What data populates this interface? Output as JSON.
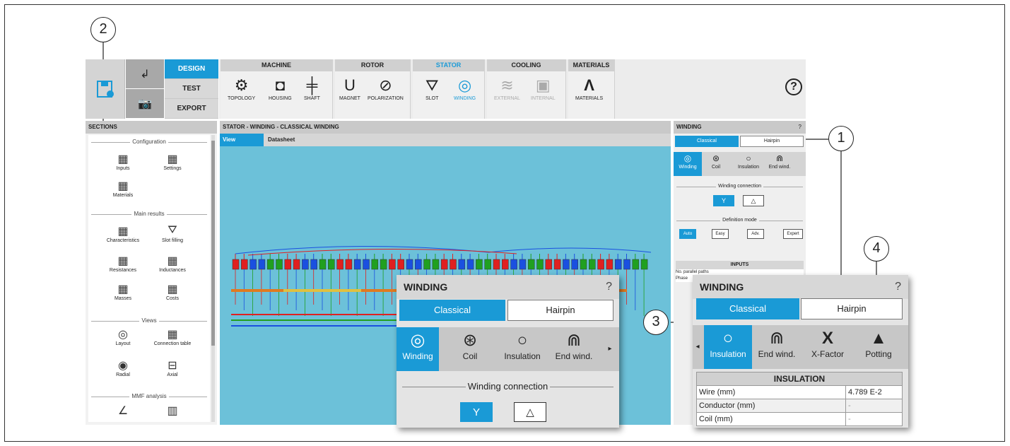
{
  "toolbar": {
    "modes": [
      "DESIGN",
      "TEST",
      "EXPORT"
    ],
    "groups": [
      {
        "title": "MACHINE",
        "tools": [
          "TOPOLOGY",
          "HOUSING",
          "SHAFT"
        ]
      },
      {
        "title": "ROTOR",
        "tools": [
          "MAGNET",
          "POLARIZATION"
        ]
      },
      {
        "title": "STATOR",
        "tools": [
          "SLOT",
          "WINDING"
        ]
      },
      {
        "title": "COOLING",
        "tools": [
          "EXTERNAL",
          "INTERNAL"
        ]
      },
      {
        "title": "MATERIALS",
        "tools": [
          "MATERIALS"
        ]
      }
    ],
    "help": "?"
  },
  "sections": {
    "header": "SECTIONS",
    "configuration": "Configuration",
    "inputs": "Inputs",
    "settings": "Settings",
    "materials": "Materials",
    "main_results": "Main results",
    "characteristics": "Characteristics",
    "slot_filling": "Slot filling",
    "resistances": "Resistances",
    "inductances": "Inductances",
    "masses": "Masses",
    "costs": "Costs",
    "views": "Views",
    "layout": "Layout",
    "connection_table": "Connection table",
    "radial": "Radial",
    "axial": "Axial",
    "mmf_analysis": "MMF analysis"
  },
  "center": {
    "title": "STATOR - WINDING - CLASSICAL WINDING",
    "tabs": [
      "View",
      "Datasheet"
    ]
  },
  "right_panel": {
    "title": "WINDING",
    "help": "?",
    "types": [
      "Classical",
      "Hairpin"
    ],
    "tabs": [
      "Winding",
      "Coil",
      "Insulation",
      "End wind."
    ],
    "winding_connection": "Winding connection",
    "definition_mode": "Definition mode",
    "modes": [
      "Auto",
      "Easy",
      "Adv.",
      "Expert"
    ],
    "inputs_header": "INPUTS",
    "input_rows": [
      "No. parallel paths",
      "Phase"
    ]
  },
  "zoom_left": {
    "title": "WINDING",
    "help": "?",
    "types": [
      "Classical",
      "Hairpin"
    ],
    "tabs": [
      "Winding",
      "Coil",
      "Insulation",
      "End wind."
    ],
    "winding_connection": "Winding connection",
    "star": "Y",
    "delta": "△"
  },
  "zoom_right": {
    "title": "WINDING",
    "help": "?",
    "types": [
      "Classical",
      "Hairpin"
    ],
    "tabs": [
      "Insulation",
      "End wind.",
      "X-Factor",
      "Potting"
    ],
    "table_header": "INSULATION",
    "rows": [
      {
        "label": "Wire (mm)",
        "value": "4.789 E-2"
      },
      {
        "label": "Conductor (mm)",
        "value": "-"
      },
      {
        "label": "Coil (mm)",
        "value": "-"
      }
    ]
  },
  "callouts": [
    "1",
    "2",
    "3",
    "4"
  ],
  "colors": {
    "accent": "#1a9ad6",
    "canvas": "#6cc1d9"
  }
}
